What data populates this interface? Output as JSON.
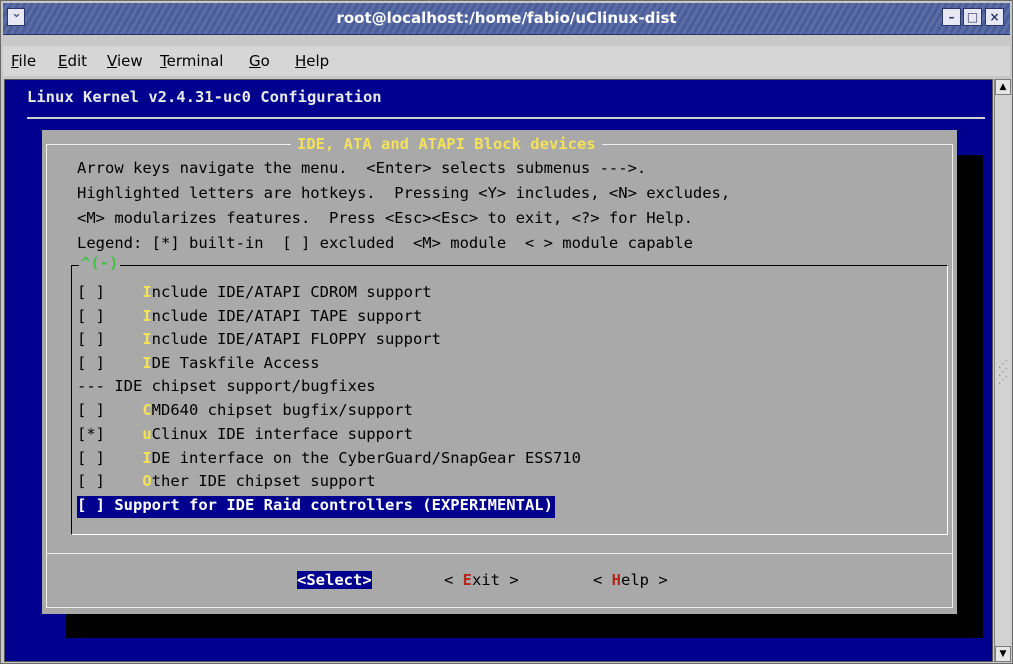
{
  "window": {
    "title": "root@localhost:/home/fabio/uClinux-dist",
    "menu_icon": "chevron-down-icon",
    "controls": [
      "minimize-icon",
      "maximize-icon",
      "close-icon"
    ]
  },
  "menubar": {
    "items": [
      {
        "label_pre": "",
        "mnemonic": "F",
        "label_post": "ile"
      },
      {
        "label_pre": "",
        "mnemonic": "E",
        "label_post": "dit"
      },
      {
        "label_pre": "",
        "mnemonic": "V",
        "label_post": "iew"
      },
      {
        "label_pre": "",
        "mnemonic": "T",
        "label_post": "erminal"
      },
      {
        "label_pre": "",
        "mnemonic": "G",
        "label_post": "o"
      },
      {
        "label_pre": "",
        "mnemonic": "H",
        "label_post": "elp"
      }
    ]
  },
  "terminal": {
    "header": "Linux Kernel v2.4.31-uc0 Configuration",
    "dialog": {
      "title": "IDE, ATA and ATAPI Block devices",
      "help_lines": [
        "Arrow keys navigate the menu.  <Enter> selects submenus --->.",
        "Highlighted letters are hotkeys.  Pressing <Y> includes, <N> excludes,",
        "<M> modularizes features.  Press <Esc><Esc> to exit, <?> for Help.",
        "Legend: [*] built-in  [ ] excluded  <M> module  < > module capable"
      ],
      "scroll_indicator": "^(-)",
      "items": [
        {
          "box": "[ ]",
          "hotkey": "I",
          "rest": "nclude IDE/ATAPI CDROM support"
        },
        {
          "box": "[ ]",
          "hotkey": "I",
          "rest": "nclude IDE/ATAPI TAPE support"
        },
        {
          "box": "[ ]",
          "hotkey": "I",
          "rest": "nclude IDE/ATAPI FLOPPY support"
        },
        {
          "box": "[ ]",
          "hotkey": "I",
          "rest": "DE Taskfile Access"
        },
        {
          "box": "---",
          "hotkey": "",
          "rest": "IDE chipset support/bugfixes"
        },
        {
          "box": "[ ]",
          "hotkey": "C",
          "rest": "MD640 chipset bugfix/support"
        },
        {
          "box": "[*]",
          "hotkey": "u",
          "rest": "Clinux IDE interface support"
        },
        {
          "box": "[ ]",
          "hotkey": "I",
          "rest": "DE interface on the CyberGuard/SnapGear ESS710"
        },
        {
          "box": "[ ]",
          "hotkey": "O",
          "rest": "ther IDE chipset support"
        },
        {
          "box": "[ ]",
          "hotkey": "",
          "rest": "Support for IDE Raid controllers (EXPERIMENTAL)"
        }
      ],
      "buttons": {
        "select": "<Select>",
        "exit_pre": "< ",
        "exit_hotkey": "E",
        "exit_post": "xit >",
        "help_pre": "< ",
        "help_hotkey": "H",
        "help_post": "elp >"
      }
    }
  },
  "colors": {
    "terminal_bg": "#00008f",
    "dialog_bg": "#a9a9a9",
    "hotkey": "#f4e25a",
    "button_hotkey": "#b3261e",
    "titlebar": "#4b5d96"
  }
}
